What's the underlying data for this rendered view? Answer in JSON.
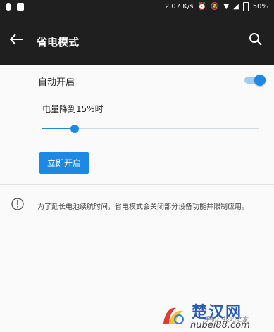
{
  "status_bar": {
    "speed": "2.07 K/s",
    "battery": "50%"
  },
  "app_bar": {
    "title": "省电模式",
    "back_icon": "arrow-left-icon",
    "search_icon": "search-icon"
  },
  "auto_enable": {
    "label": "自动开启",
    "toggle_on": true
  },
  "threshold": {
    "label": "电量降到15%时",
    "value_percent": 15
  },
  "primary_button": {
    "label": "立即开启"
  },
  "info": {
    "icon": "info-icon",
    "text": "为了延长电池续航时间，省电模式会关闭部分设备功能并限制应用。"
  },
  "watermark": {
    "title": "楚汉网",
    "domain": "hubei88.com",
    "overlay_text": "手机小技巧之家"
  },
  "colors": {
    "accent": "#1e88e5",
    "appbar_bg": "#1f1f1f"
  }
}
